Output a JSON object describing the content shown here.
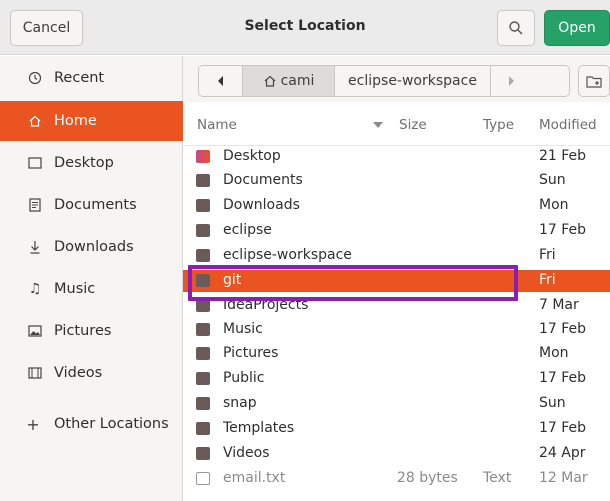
{
  "header": {
    "cancel_label": "Cancel",
    "title": "Select Location",
    "open_label": "Open"
  },
  "sidebar": {
    "items": [
      {
        "label": "Recent",
        "icon": "clock-icon"
      },
      {
        "label": "Home",
        "icon": "home-icon"
      },
      {
        "label": "Desktop",
        "icon": "desktop-icon"
      },
      {
        "label": "Documents",
        "icon": "document-icon"
      },
      {
        "label": "Downloads",
        "icon": "download-icon"
      },
      {
        "label": "Music",
        "icon": "music-icon"
      },
      {
        "label": "Pictures",
        "icon": "picture-icon"
      },
      {
        "label": "Videos",
        "icon": "video-icon"
      },
      {
        "label": "Other Locations",
        "icon": "plus-icon"
      }
    ]
  },
  "pathbar": {
    "home_segment": "cami",
    "current_segment": "eclipse-workspace"
  },
  "columns": {
    "name": "Name",
    "size": "Size",
    "type": "Type",
    "modified": "Modified"
  },
  "files": [
    {
      "name": "Desktop",
      "size": "",
      "type": "",
      "modified": "21 Feb"
    },
    {
      "name": "Documents",
      "size": "",
      "type": "",
      "modified": "Sun"
    },
    {
      "name": "Downloads",
      "size": "",
      "type": "",
      "modified": "Mon"
    },
    {
      "name": "eclipse",
      "size": "",
      "type": "",
      "modified": "17 Feb"
    },
    {
      "name": "eclipse-workspace",
      "size": "",
      "type": "",
      "modified": "Fri"
    },
    {
      "name": "git",
      "size": "",
      "type": "",
      "modified": "Fri"
    },
    {
      "name": "IdeaProjects",
      "size": "",
      "type": "",
      "modified": "7 Mar"
    },
    {
      "name": "Music",
      "size": "",
      "type": "",
      "modified": "17 Feb"
    },
    {
      "name": "Pictures",
      "size": "",
      "type": "",
      "modified": "Mon"
    },
    {
      "name": "Public",
      "size": "",
      "type": "",
      "modified": "17 Feb"
    },
    {
      "name": "snap",
      "size": "",
      "type": "",
      "modified": "Sun"
    },
    {
      "name": "Templates",
      "size": "",
      "type": "",
      "modified": "17 Feb"
    },
    {
      "name": "Videos",
      "size": "",
      "type": "",
      "modified": "24 Apr"
    },
    {
      "name": "email.txt",
      "size": "28 bytes",
      "type": "Text",
      "modified": "12 Mar"
    }
  ],
  "colors": {
    "accent": "#e95420",
    "open_button": "#26a269",
    "highlight_box": "#8b1fb0"
  }
}
